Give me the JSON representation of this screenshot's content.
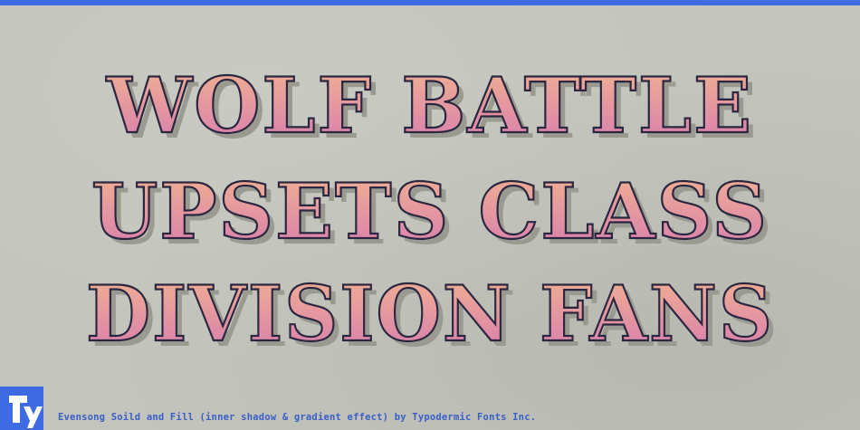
{
  "headline": {
    "lines": [
      "WOLF BATTLE",
      "UPSETS CLASS",
      "DIVISION FANS"
    ]
  },
  "caption": "Evensong Soild and Fill (inner shadow & gradient effect) by Typodermic Fonts Inc.",
  "colors": {
    "background": "#c3c4bc",
    "accent": "#3e6ae4",
    "letter_fill_top": "#f2b48f",
    "letter_fill_bottom": "#d77bb0",
    "letter_outline": "#2b2740",
    "letter_shadow": "#9b9a91"
  }
}
